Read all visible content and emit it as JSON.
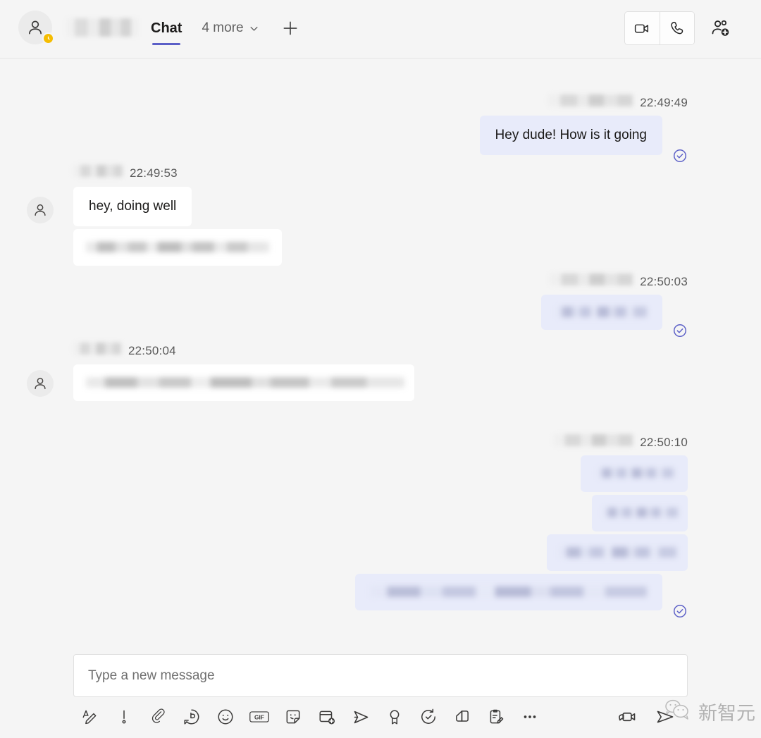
{
  "header": {
    "avatar_icon": "person-icon",
    "status": "away",
    "status_icon": "clock-icon",
    "contact_name_redacted": true,
    "tab_label": "Chat",
    "more_tabs_label": "4 more",
    "chevron_icon": "chevron-down-icon",
    "add_tab_icon": "plus-icon",
    "video_call_icon": "video-camera-icon",
    "audio_call_icon": "phone-icon",
    "add_people_icon": "add-person-icon",
    "accent_color": "#5b5fc7",
    "status_color": "#f5bd02"
  },
  "conversation": {
    "messages": [
      {
        "id": "m1",
        "direction": "outgoing",
        "sender_redacted": true,
        "time": "22:49:49",
        "bubbles": [
          {
            "text": "Hey dude! How is it going",
            "redacted": false
          }
        ],
        "status_icon": "check-circle-icon",
        "delivered": true
      },
      {
        "id": "m2",
        "direction": "incoming",
        "sender_redacted": true,
        "time": "22:49:53",
        "avatar_icon": "person-icon",
        "bubbles": [
          {
            "text": "hey, doing well",
            "redacted": false
          },
          {
            "text": "",
            "redacted": true
          }
        ]
      },
      {
        "id": "m3",
        "direction": "outgoing",
        "sender_redacted": true,
        "time": "22:50:03",
        "bubbles": [
          {
            "text": "",
            "redacted": true
          }
        ],
        "status_icon": "check-circle-icon",
        "delivered": true
      },
      {
        "id": "m4",
        "direction": "incoming",
        "sender_redacted": true,
        "time": "22:50:04",
        "avatar_icon": "person-icon",
        "bubbles": [
          {
            "text": "",
            "redacted": true
          }
        ]
      },
      {
        "id": "m5",
        "direction": "outgoing",
        "sender_redacted": true,
        "time": "22:50:10",
        "bubbles": [
          {
            "text": "",
            "redacted": true
          },
          {
            "text": "",
            "redacted": true
          },
          {
            "text": "",
            "redacted": true
          },
          {
            "text": "",
            "redacted": true
          }
        ],
        "status_icon": "check-circle-icon",
        "delivered": true
      }
    ]
  },
  "composer": {
    "placeholder": "Type a new message",
    "value": "",
    "tools": [
      {
        "name": "format-icon",
        "label": "Format"
      },
      {
        "name": "important-icon",
        "label": "Set delivery options"
      },
      {
        "name": "attach-icon",
        "label": "Attach"
      },
      {
        "name": "loop-icon",
        "label": "Loop components"
      },
      {
        "name": "emoji-icon",
        "label": "Emoji"
      },
      {
        "name": "gif-icon",
        "label": "GIF"
      },
      {
        "name": "sticker-icon",
        "label": "Sticker"
      },
      {
        "name": "meet-now-icon",
        "label": "Schedule a meeting"
      },
      {
        "name": "send-plane-icon",
        "label": "Stream"
      },
      {
        "name": "praise-icon",
        "label": "Praise"
      },
      {
        "name": "schedule-send-icon",
        "label": "Schedule send"
      },
      {
        "name": "apps-icon",
        "label": "Apps"
      },
      {
        "name": "forms-icon",
        "label": "Forms"
      },
      {
        "name": "more-options-icon",
        "label": "More options"
      }
    ],
    "right_tools": [
      {
        "name": "video-message-icon",
        "label": "Record video clip"
      },
      {
        "name": "send-icon",
        "label": "Send"
      }
    ]
  },
  "watermark": {
    "text": "新智元",
    "logo_icon": "wechat-icon"
  }
}
